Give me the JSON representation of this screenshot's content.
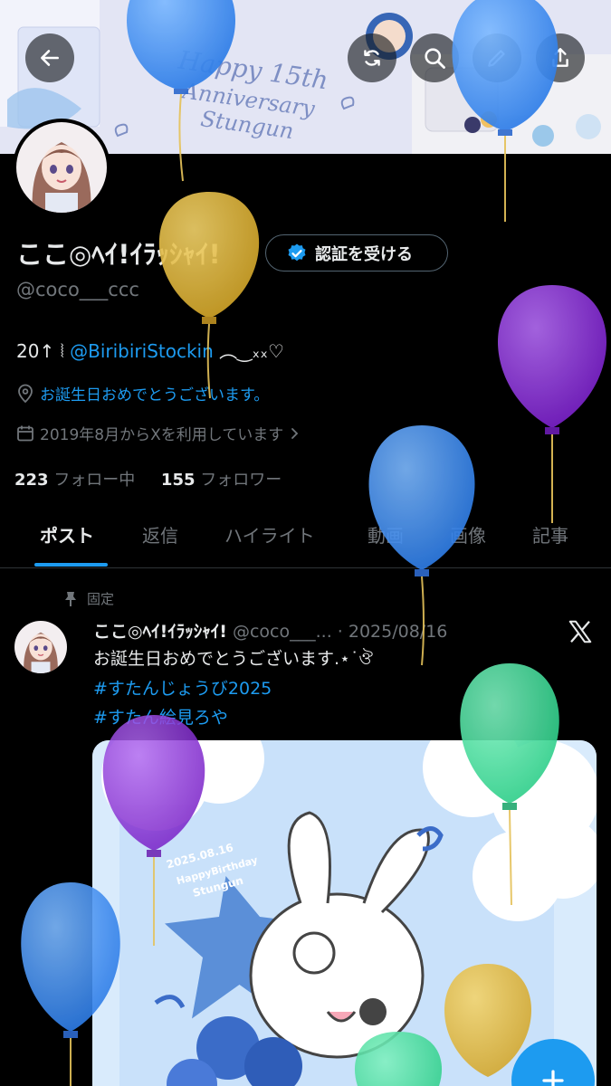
{
  "header": {
    "banner_text_line1": "Happy 15th",
    "banner_text_line2": "Anniversary",
    "banner_text_line3": "Stungun"
  },
  "profile": {
    "display_name": "ここ◎ﾍｲ!ｲﾗｯｼｬｲ!",
    "verify_label": "認証を受ける",
    "handle": "@coco___ccc",
    "bio_prefix": "20↑ ⦚ ",
    "bio_mention": "@BiribiriStockin",
    "bio_suffix": " ︵‿ₓₓ♡",
    "location": "お誕生日おめでとうございます。",
    "joined": "2019年8月からXを利用しています",
    "following_count": "223",
    "following_label": "フォロー中",
    "followers_count": "155",
    "followers_label": "フォロワー"
  },
  "tabs": [
    {
      "label": "ポスト",
      "active": true
    },
    {
      "label": "返信",
      "active": false
    },
    {
      "label": "ハイライト",
      "active": false
    },
    {
      "label": "動画",
      "active": false
    },
    {
      "label": "画像",
      "active": false
    },
    {
      "label": "記事",
      "active": false
    }
  ],
  "post": {
    "pinned_label": "固定",
    "author_name": "ここ◎ﾍｲ!ｲﾗｯｼｬｲ!",
    "author_handle": "@coco___...",
    "separator": " · ",
    "date": "2025/08/16",
    "text": "お誕生日おめでとうございます.⋆˙ঔ",
    "hashtag1": "#すたんじょうび2025",
    "hashtag2": "#すたん絵見ろや",
    "image_badge_date": "2025.08.16",
    "image_badge_line1": "HappyBirthday",
    "image_badge_line2": "Stungun"
  },
  "colors": {
    "accent": "#1d9bf0",
    "background": "#000000",
    "text_primary": "#e7e9ea",
    "text_secondary": "#71767b",
    "balloon_blue": "#3d8ef0",
    "balloon_yellow": "#e2b93a",
    "balloon_purple": "#8a2fd6",
    "balloon_green": "#3fdc9e"
  },
  "icons": [
    "back-arrow-icon",
    "refresh-icon",
    "search-icon",
    "edit-icon",
    "share-icon",
    "verified-badge-icon",
    "location-icon",
    "calendar-icon",
    "chevron-right-icon",
    "pin-icon",
    "x-logo-icon",
    "plus-icon"
  ]
}
